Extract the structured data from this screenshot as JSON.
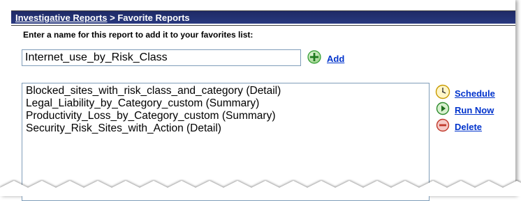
{
  "breadcrumb": {
    "link_label": "Investigative Reports",
    "separator": " > ",
    "current": "Favorite Reports"
  },
  "form": {
    "prompt": "Enter a name for this report to add it to your favorites list:",
    "name_value": "Internet_use_by_Risk_Class",
    "add_label": "Add"
  },
  "favorites": {
    "items": [
      "Blocked_sites_with_risk_class_and_category (Detail)",
      "Legal_Liability_by_Category_custom (Summary)",
      "Productivity_Loss_by_Category_custom (Summary)",
      "Security_Risk_Sites_with_Action (Detail)"
    ]
  },
  "actions": {
    "schedule_label": "Schedule",
    "run_now_label": "Run Now",
    "delete_label": "Delete"
  },
  "colors": {
    "header_bg": "#233273",
    "link": "#0033cc",
    "add_icon": "#2e9a2e",
    "run_icon": "#2e8b2e",
    "delete_icon": "#d9534f",
    "clock_icon": "#e0b000"
  }
}
